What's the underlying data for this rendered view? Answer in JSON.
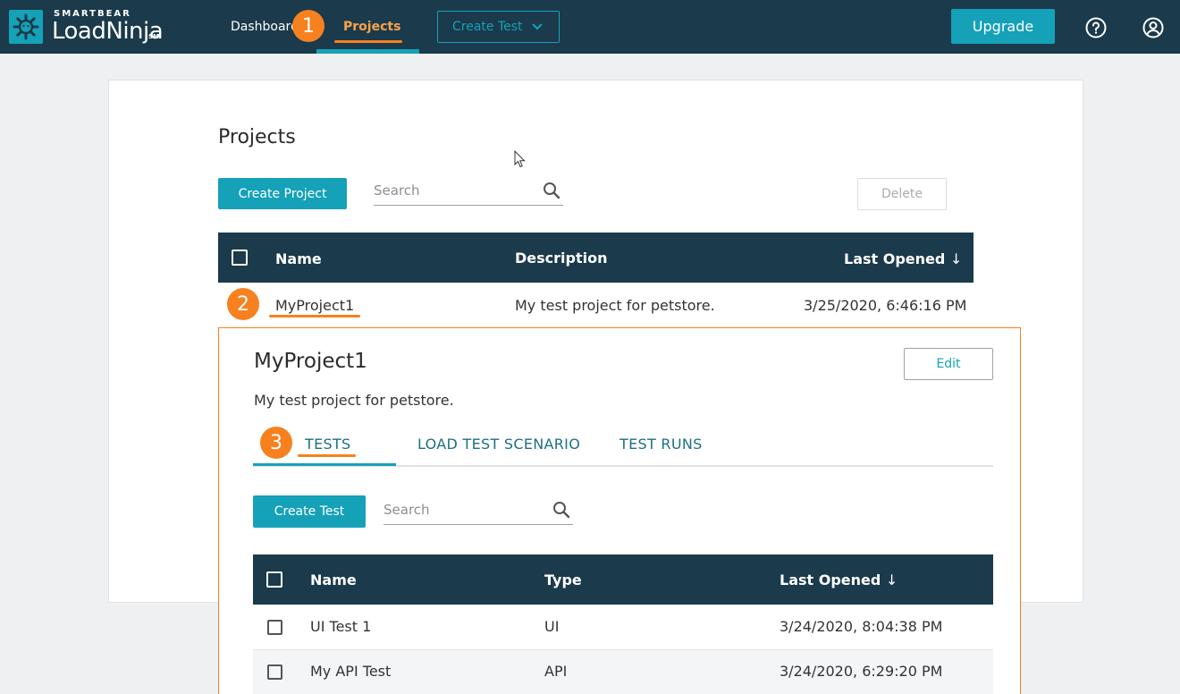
{
  "header": {
    "brand_top": "SMARTBEAR",
    "brand_name": "LoadNinja",
    "brand_mark": "SM",
    "nav": {
      "dashboard": "Dashboard",
      "projects": "Projects"
    },
    "create_test": "Create Test",
    "upgrade": "Upgrade"
  },
  "badges": {
    "one": "1",
    "two": "2",
    "three": "3"
  },
  "projects_page": {
    "title": "Projects",
    "create_project": "Create Project",
    "search_placeholder": "Search",
    "delete": "Delete",
    "columns": {
      "name": "Name",
      "description": "Description",
      "last_opened": "Last Opened"
    },
    "rows": [
      {
        "name": "MyProject1",
        "description": "My test project for petstore.",
        "last_opened": "3/25/2020, 6:46:16 PM"
      }
    ]
  },
  "project_detail": {
    "title": "MyProject1",
    "edit": "Edit",
    "description": "My test project for petstore.",
    "tabs": {
      "tests": "TESTS",
      "scenario": "LOAD TEST SCENARIO",
      "runs": "TEST RUNS"
    },
    "create_test": "Create Test",
    "search_placeholder": "Search",
    "columns": {
      "name": "Name",
      "type": "Type",
      "last_opened": "Last Opened"
    },
    "rows": [
      {
        "name": "UI Test 1",
        "type": "UI",
        "last_opened": "3/24/2020, 8:04:38 PM"
      },
      {
        "name": "My API Test",
        "type": "API",
        "last_opened": "3/24/2020, 6:29:20 PM"
      }
    ]
  },
  "colors": {
    "navbar": "#1b3a4b",
    "accent": "#15a1b8",
    "callout": "#f7811e"
  }
}
